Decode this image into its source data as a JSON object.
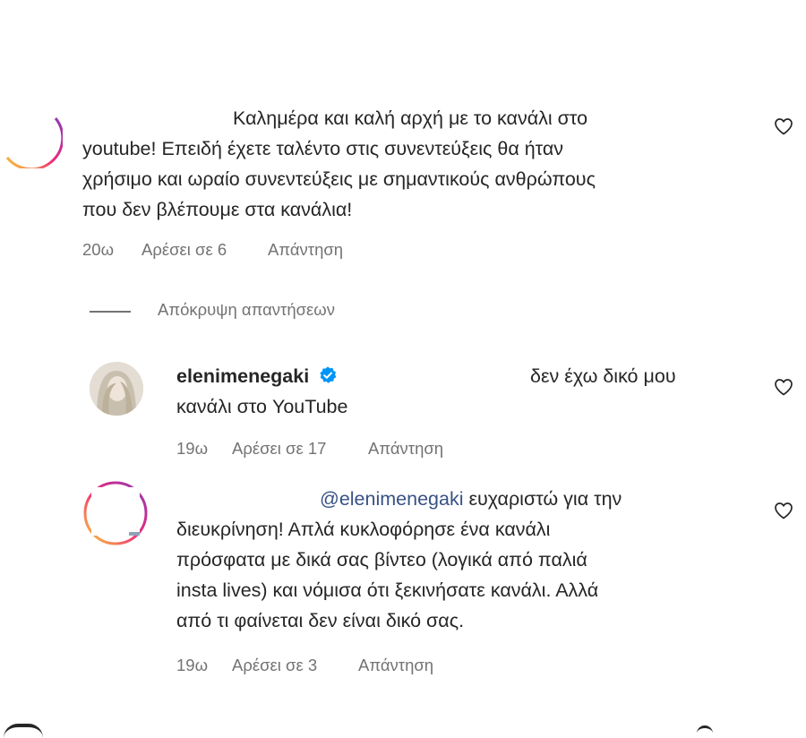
{
  "comments": [
    {
      "text_lines": [
        "Καλημέρα και καλή αρχή με το κανάλι στο",
        "youtube! Επειδή έχετε ταλέντο στις συνεντεύξεις θα ήταν",
        "χρήσιμο και ωραίο συνεντεύξεις με σημαντικούς ανθρώπους",
        "που δεν βλέπουμε στα κανάλια!"
      ],
      "time": "20ω",
      "likes": "Αρέσει σε 6",
      "reply": "Απάντηση"
    }
  ],
  "toggle_replies": "Απόκρυψη απαντήσεων",
  "replies": [
    {
      "username": "elenimenegaki",
      "verified": true,
      "text_line1": "δεν έχω δικό μου",
      "text_line2": "κανάλι στο YouTube",
      "time": "19ω",
      "likes": "Αρέσει σε 17",
      "reply": "Απάντηση"
    },
    {
      "mention": "@elenimenegaki",
      "text_first": "ευχαριστώ για την",
      "text_lines": [
        "διευκρίνηση! Απλά κυκλοφόρησε ένα κανάλι",
        "πρόσφατα με δικά σας βίντεο (λογικά από παλιά",
        "insta lives) και νόμισα ότι ξεκινήσατε κανάλι. Αλλά",
        "από τι φαίνεται δεν είναι δικό σας."
      ],
      "time": "19ω",
      "likes": "Αρέσει σε 3",
      "reply": "Απάντηση"
    }
  ],
  "colors": {
    "text": "#262626",
    "meta": "#737373",
    "verified": "#0095f6",
    "mention": "#385185"
  },
  "icons": [
    "heart-outline-icon",
    "verified-badge-icon"
  ]
}
